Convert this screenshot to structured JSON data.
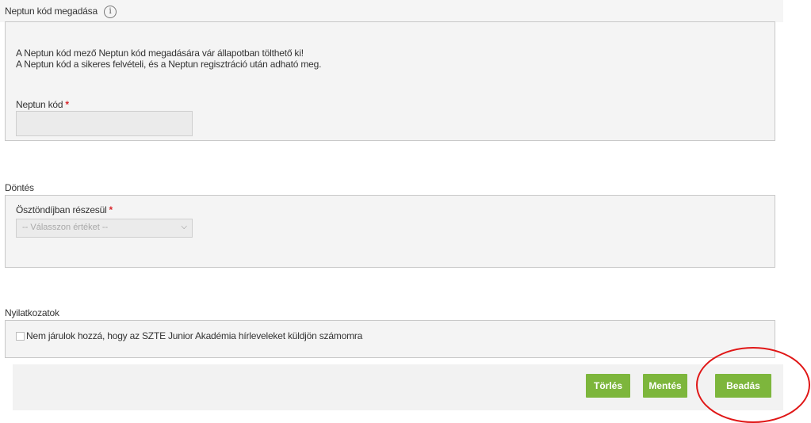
{
  "neptun_section": {
    "title": "Neptun kód megadása",
    "info_icon_glyph": "i",
    "notice_line1": "A Neptun kód mező Neptun kód megadására vár állapotban tölthető ki!",
    "notice_line2": "A Neptun kód a sikeres felvételi, és a Neptun regisztráció után adható meg.",
    "field_label": "Neptun kód",
    "required_mark": "*",
    "value": ""
  },
  "decision_section": {
    "title": "Döntés",
    "field_label": "Ösztöndíjban részesül",
    "required_mark": "*",
    "select_value": "-- Válasszon értéket --"
  },
  "statements_section": {
    "title": "Nyilatkozatok",
    "checkbox_label": "Nem járulok hozzá, hogy az SZTE Junior Akadémia hírleveleket küldjön számomra",
    "checked": false
  },
  "actions": {
    "delete_label": "Törlés",
    "save_label": "Mentés",
    "submit_label": "Beadás"
  },
  "colors": {
    "button_green": "#7db63c",
    "required_red": "#d9262c",
    "highlight_red": "#e01717",
    "panel_bg": "#f4f4f4"
  },
  "icons": {
    "info": "info-icon",
    "select_arrow": "chevron-down-icon"
  }
}
